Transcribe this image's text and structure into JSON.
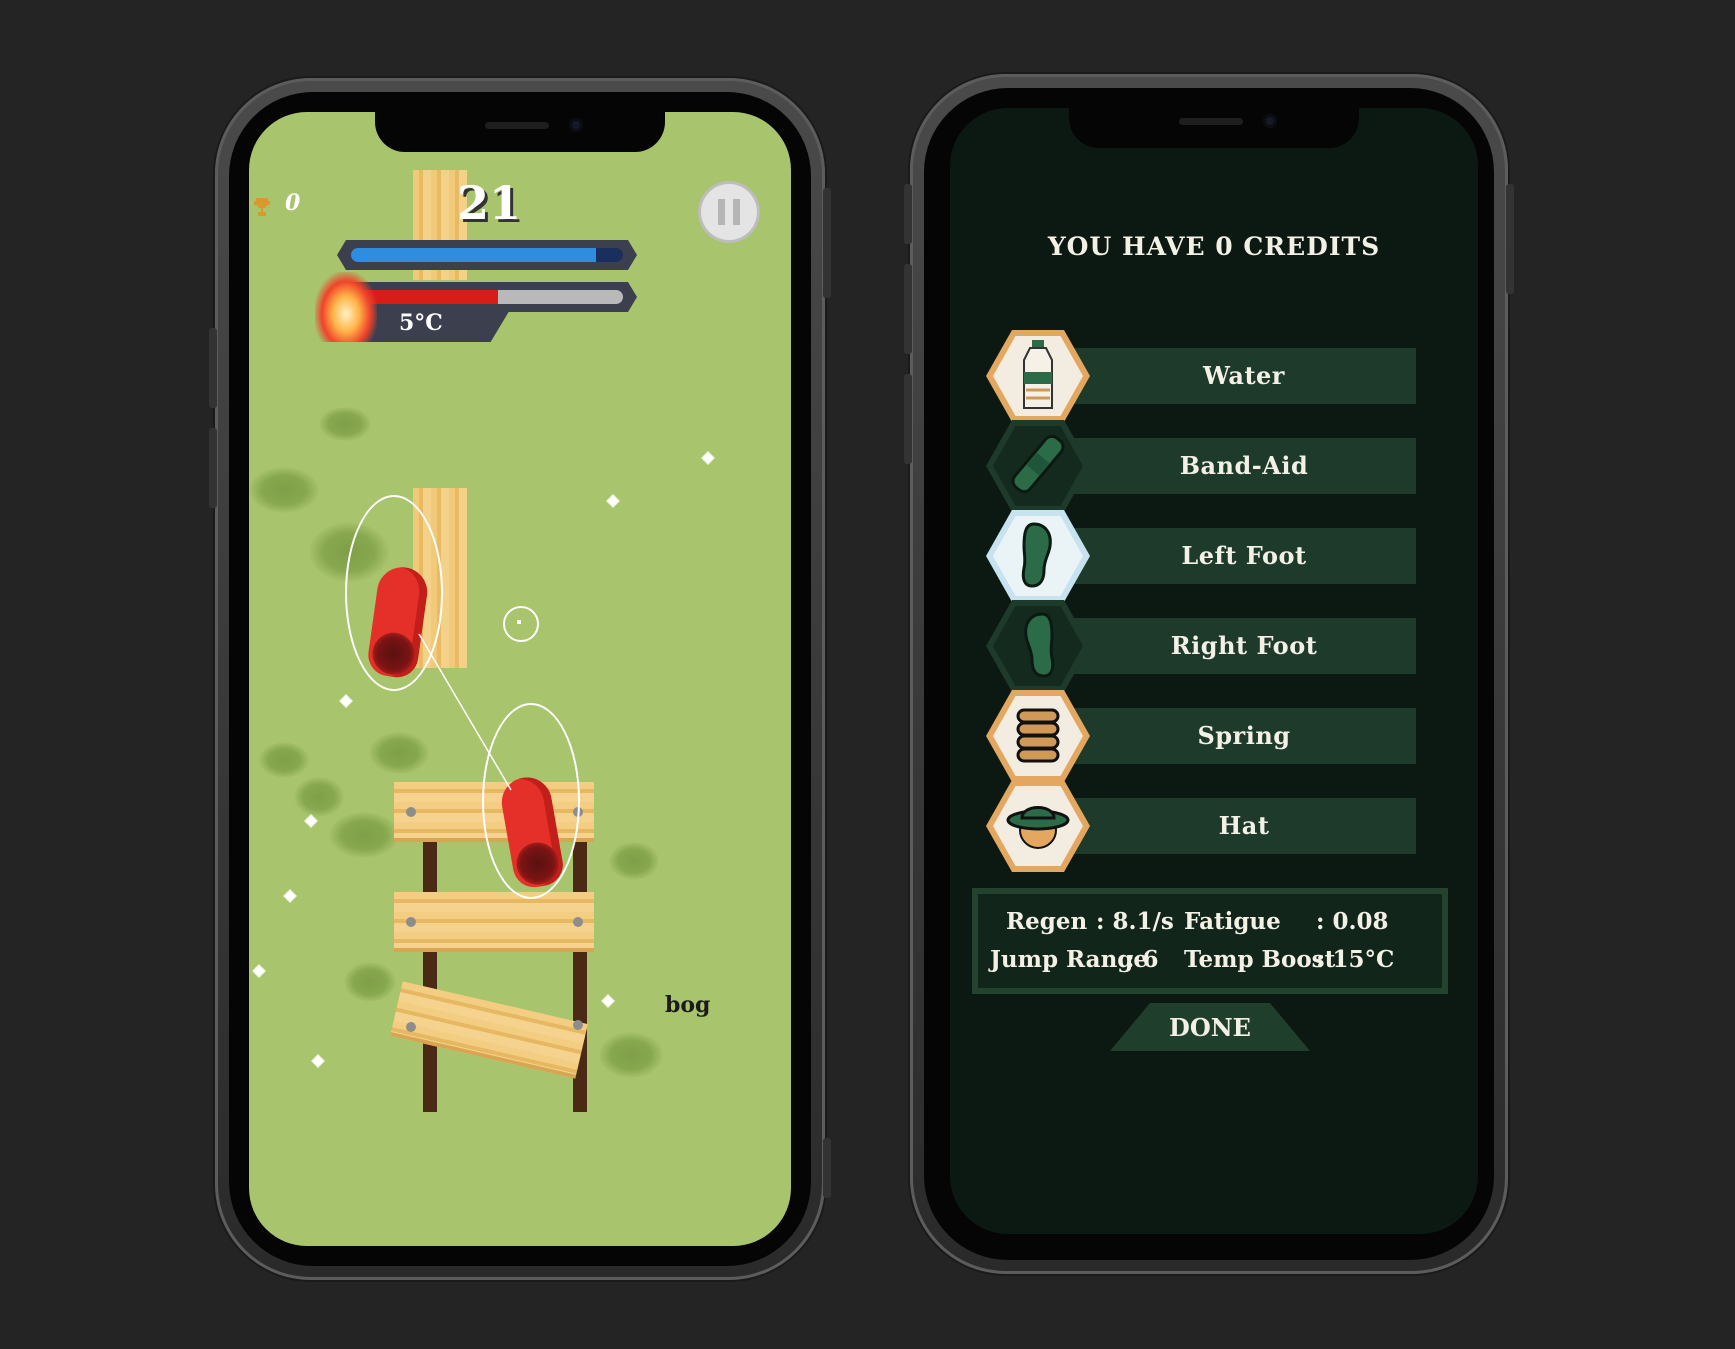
{
  "game_screen": {
    "trophy_count": "0",
    "score": "21",
    "temperature": "5°C",
    "stamina_level": 0.9,
    "heat_level": 0.54,
    "location_label": "bog",
    "colors": {
      "grass": "#a8c46c",
      "stamina": "#2f8de0",
      "heat": "#d81c16",
      "wood": "#f1c978",
      "foot": "#e5302a"
    },
    "icons": {
      "trophy": "trophy-icon",
      "pause": "pause-icon",
      "fire": "fire-icon"
    }
  },
  "shop_screen": {
    "title": "YOU HAVE 0 CREDITS",
    "items": [
      {
        "label": "Water",
        "icon": "water-bottle-icon",
        "hex_color": "#e3a75f"
      },
      {
        "label": "Band-Aid",
        "icon": "band-aid-icon",
        "hex_color": "#1d3a2b"
      },
      {
        "label": "Left Foot",
        "icon": "left-foot-icon",
        "hex_color": "#c7e3ef"
      },
      {
        "label": "Right Foot",
        "icon": "right-foot-icon",
        "hex_color": "#1d3a2b"
      },
      {
        "label": "Spring",
        "icon": "spring-icon",
        "hex_color": "#e3a75f"
      },
      {
        "label": "Hat",
        "icon": "hat-icon",
        "hex_color": "#e3a75f"
      }
    ],
    "stats": {
      "regen_label": "Regen",
      "regen_value": ": 8.1/s",
      "fatigue_label": "Fatigue",
      "fatigue_value": ": 0.08",
      "jump_label": "Jump Range",
      "jump_value": ": 6",
      "temp_label": "Temp Boost",
      "temp_value": ": 15°C"
    },
    "done_label": "DONE"
  }
}
